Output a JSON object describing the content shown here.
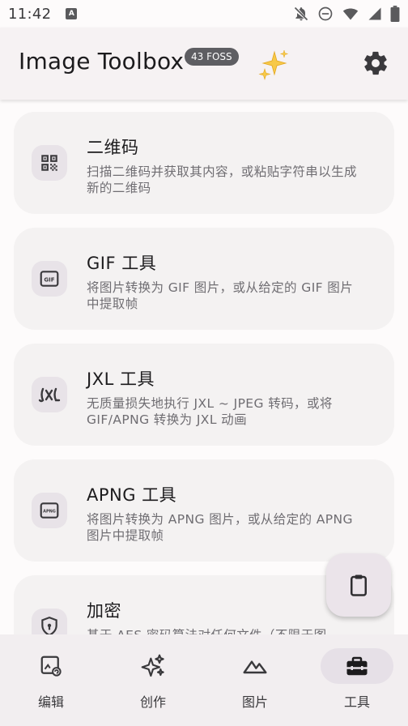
{
  "status_bar": {
    "time": "11:42"
  },
  "header": {
    "title": "Image Toolbox",
    "badge": "43 FOSS"
  },
  "tools": [
    {
      "title": "二维码",
      "description": "扫描二维码并获取其内容，或粘贴字符串以生成新的二维码",
      "icon": "qr-code-icon"
    },
    {
      "title": "GIF 工具",
      "description": "将图片转换为 GIF 图片，或从给定的 GIF 图片中提取帧",
      "icon": "gif-icon"
    },
    {
      "title": "JXL 工具",
      "description": "无质量损失地执行 JXL ~ JPEG 转码，或将 GIF/APNG 转换为 JXL 动画",
      "icon": "jxl-icon"
    },
    {
      "title": "APNG 工具",
      "description": "将图片转换为 APNG 图片，或从给定的 APNG 图片中提取帧",
      "icon": "apng-icon"
    },
    {
      "title": "加密",
      "description": "基于 AES 密码算法对任何文件（不限于图",
      "icon": "shield-lock-icon"
    }
  ],
  "nav": [
    {
      "label": "编辑",
      "icon": "image-edit-icon",
      "active": false
    },
    {
      "label": "创作",
      "icon": "sparkle-create-icon",
      "active": false
    },
    {
      "label": "图片",
      "icon": "image-landscape-icon",
      "active": false
    },
    {
      "label": "工具",
      "icon": "toolbox-icon",
      "active": true
    }
  ],
  "fab": {
    "icon": "clipboard-icon"
  },
  "colors": {
    "card": "#f4f2f2",
    "icon_box": "#e8e3e8",
    "fab": "#ebe4ea",
    "nav_active": "#e6e0e7"
  }
}
